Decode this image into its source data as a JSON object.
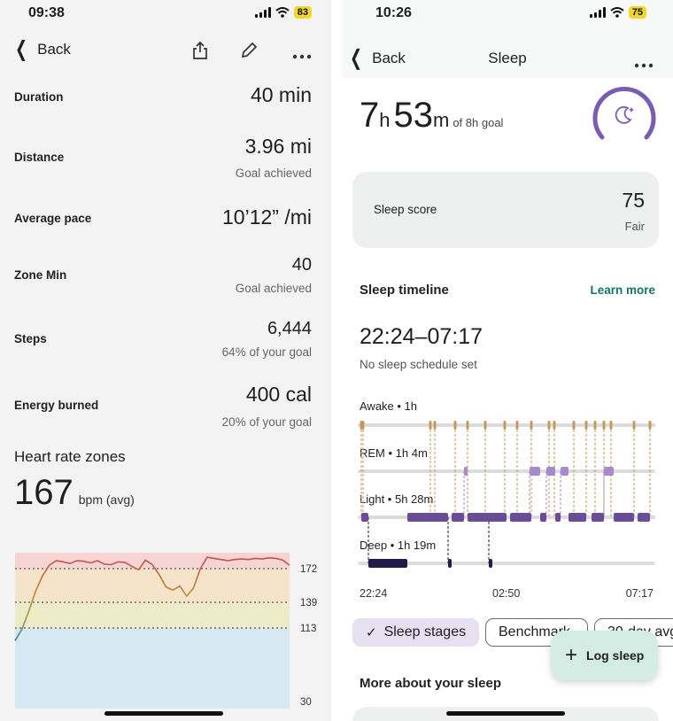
{
  "left": {
    "status": {
      "time": "09:38",
      "battery": "83"
    },
    "nav": {
      "back_label": "Back"
    },
    "metrics": [
      {
        "label": "Duration",
        "value": "40 min",
        "sub": ""
      },
      {
        "label": "Distance",
        "value": "3.96 mi",
        "sub": "Goal achieved"
      },
      {
        "label": "Average pace",
        "value": "10’12” /mi",
        "sub": ""
      },
      {
        "label": "Zone Min",
        "value": "40",
        "sub": "Goal achieved"
      },
      {
        "label": "Steps",
        "value": "6,444",
        "sub": "64% of your goal"
      },
      {
        "label": "Energy burned",
        "value": "400 cal",
        "sub": "20% of your goal"
      }
    ],
    "heart_rate": {
      "title": "Heart rate zones",
      "avg_value": "167",
      "avg_unit": "bpm (avg)",
      "zone_labels": [
        "172",
        "139",
        "113",
        "30"
      ]
    }
  },
  "right": {
    "status": {
      "time": "10:26",
      "battery": "75"
    },
    "nav": {
      "back_label": "Back",
      "title": "Sleep"
    },
    "duration": {
      "hours": "7",
      "h_unit": "h",
      "minutes": "53",
      "m_unit": "m",
      "goal": "of 8h goal"
    },
    "score": {
      "label": "Sleep score",
      "value": "75",
      "rating": "Fair"
    },
    "timeline": {
      "title": "Sleep timeline",
      "learn_more": "Learn more",
      "range": "22:24–07:17",
      "schedule_note": "No sleep schedule set",
      "stages": [
        {
          "label": "Awake • 1h",
          "color": "#c49a5c"
        },
        {
          "label": "REM • 1h 4m",
          "color": "#a889c9"
        },
        {
          "label": "Light • 5h 28m",
          "color": "#6a4c97"
        },
        {
          "label": "Deep • 1h 19m",
          "color": "#231a47"
        }
      ],
      "x_ticks": [
        "22:24",
        "02:50",
        "07:17"
      ]
    },
    "chips": [
      "Sleep stages",
      "Benchmark",
      "30-day avg"
    ],
    "fab_label": "Log sleep",
    "more_title": "More about your sleep"
  },
  "chart_data": {
    "type": "line",
    "title": "Heart rate zones",
    "ylabel": "",
    "xlabel": "",
    "y_tick_labels": [
      172,
      139,
      113,
      30
    ],
    "ylim": [
      30,
      200
    ],
    "zones": [
      {
        "from": 172,
        "to": 200,
        "color": "#f6d4d4"
      },
      {
        "from": 139,
        "to": 172,
        "color": "#f5e4c9"
      },
      {
        "from": 113,
        "to": 139,
        "color": "#eeebc8"
      },
      {
        "from": 30,
        "to": 113,
        "color": "#d6e8f1"
      }
    ],
    "series": [
      {
        "x": [
          0,
          1,
          2,
          3,
          4,
          5,
          6,
          7,
          8,
          9,
          10,
          11,
          12,
          13,
          14,
          15,
          16,
          17,
          18,
          19,
          20,
          21,
          22,
          23,
          24,
          25,
          26,
          27,
          28,
          29,
          30,
          31,
          32,
          33,
          34,
          35,
          36,
          37,
          38,
          39,
          40
        ],
        "values": [
          100,
          112,
          130,
          150,
          165,
          178,
          186,
          184,
          181,
          186,
          185,
          182,
          186,
          180,
          179,
          184,
          183,
          176,
          171,
          187,
          179,
          166,
          154,
          151,
          155,
          145,
          153,
          172,
          192,
          190,
          188,
          186,
          188,
          189,
          188,
          190,
          189,
          191,
          190,
          187,
          178
        ]
      }
    ]
  }
}
